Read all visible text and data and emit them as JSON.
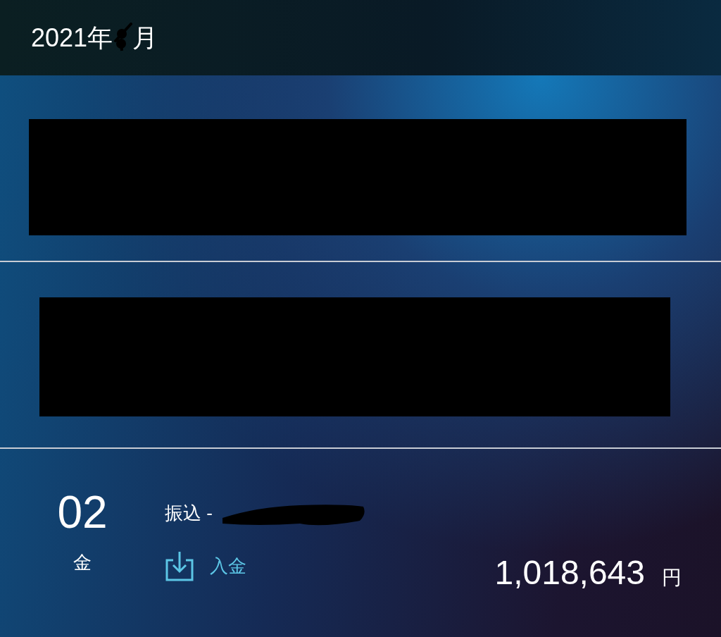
{
  "header": {
    "year_text": "2021年",
    "month_redacted": true,
    "month_text": "月"
  },
  "transactions": [
    {
      "kind": "redacted"
    },
    {
      "kind": "redacted"
    },
    {
      "kind": "entry",
      "day": "02",
      "weekday": "金",
      "description": "振込 -",
      "description_redacted": true,
      "type": "入金",
      "amount": "1,018,643",
      "unit": "円"
    }
  ]
}
